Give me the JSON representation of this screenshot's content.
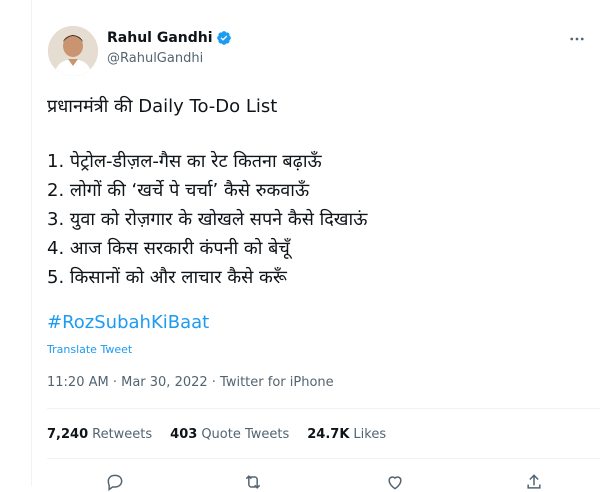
{
  "author": {
    "name": "Rahul Gandhi",
    "handle": "@RahulGandhi"
  },
  "tweet": {
    "title": "प्रधानमंत्री की Daily To-Do List",
    "items": [
      "1. पेट्रोल-डीज़ल-गैस का रेट कितना बढ़ाऊँ",
      "2. लोगों की ‘खर्चे पे चर्चा’ कैसे रुकवाऊँ",
      "3. युवा को रोज़गार के खोखले सपने कैसे दिखाऊं",
      "4. आज किस सरकारी कंपनी को बेचूँ",
      "5. किसानों को और लाचार कैसे करूँ"
    ],
    "hashtag": "#RozSubahKiBaat",
    "translate_label": "Translate Tweet",
    "timestamp": "11:20 AM · Mar 30, 2022 · Twitter for iPhone"
  },
  "stats": {
    "retweets_count": "7,240",
    "retweets_label": "Retweets",
    "quotes_count": "403",
    "quotes_label": "Quote Tweets",
    "likes_count": "24.7K",
    "likes_label": "Likes"
  },
  "colors": {
    "accent": "#1d9bf0",
    "text": "#0f1419",
    "secondary": "#536471",
    "border": "#eff3f4"
  },
  "icons": [
    "verified-badge-icon",
    "more-icon",
    "reply-icon",
    "retweet-icon",
    "like-icon",
    "share-icon"
  ]
}
